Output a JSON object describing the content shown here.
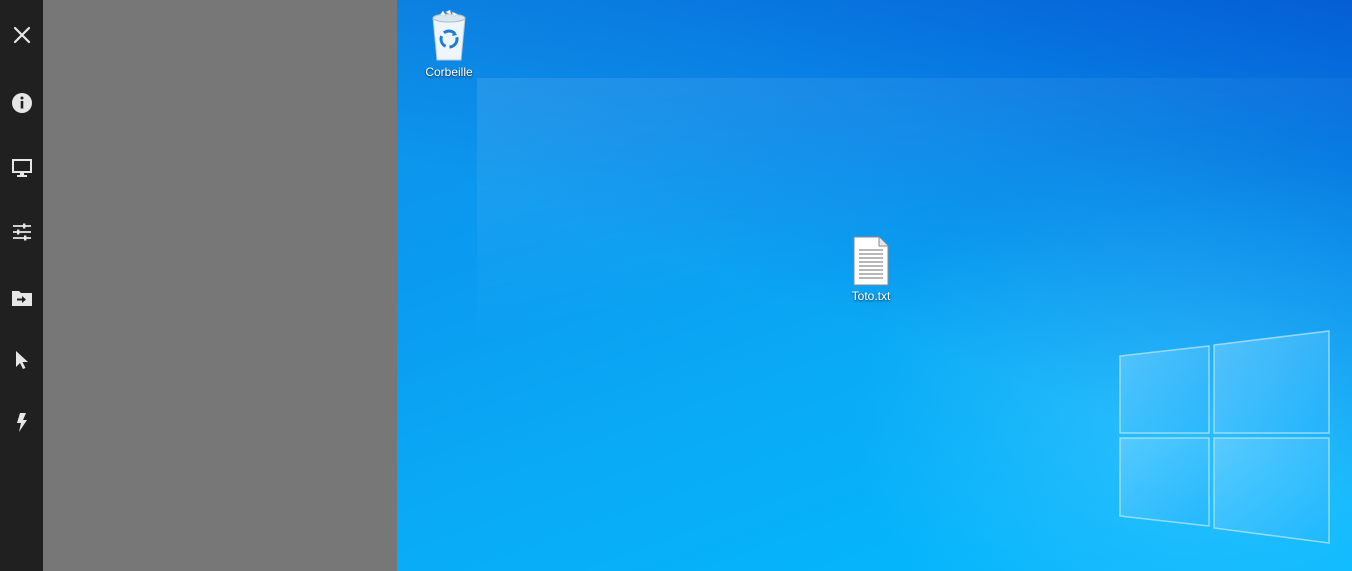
{
  "toolbar": {
    "items": [
      {
        "icon": "close-icon"
      },
      {
        "icon": "info-icon"
      },
      {
        "icon": "monitor-icon"
      },
      {
        "icon": "sliders-icon"
      },
      {
        "icon": "folder-transfer-icon"
      },
      {
        "icon": "cursor-icon"
      },
      {
        "icon": "lightning-icon"
      }
    ]
  },
  "desktop": {
    "icons": [
      {
        "label": "Corbeille",
        "icon": "recycle-bin-icon"
      },
      {
        "label": "Toto.txt",
        "icon": "text-file-icon"
      }
    ],
    "colors": {
      "wallpaper_light": "#00b9ff",
      "wallpaper_dark": "#0b4fd0"
    }
  },
  "panel": {
    "color": "#777777"
  }
}
